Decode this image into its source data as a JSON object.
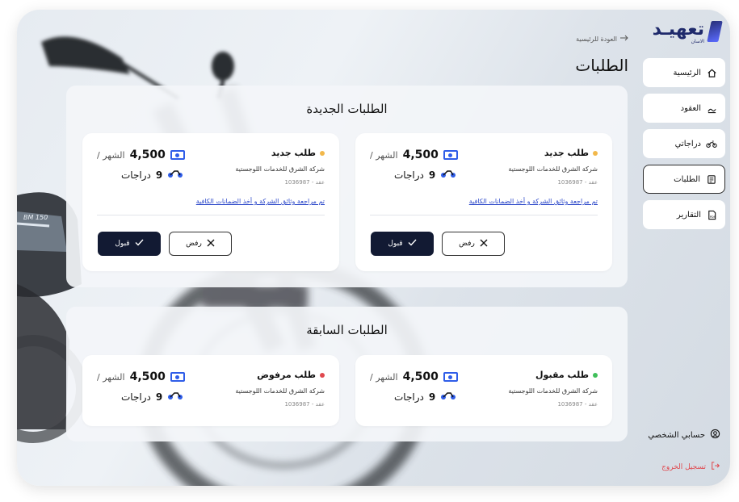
{
  "brand": {
    "name": "تعهيـد",
    "sub": "الاسان"
  },
  "nav": [
    {
      "label": "الرئيسية",
      "icon": "home-icon"
    },
    {
      "label": "العقود",
      "icon": "contract-icon"
    },
    {
      "label": "دراجاتي",
      "icon": "motorcycle-icon"
    },
    {
      "label": "الطلبات",
      "icon": "requests-icon",
      "active": true
    },
    {
      "label": "التقارير",
      "icon": "pdf-report-icon"
    }
  ],
  "profile": {
    "label": "حسابي الشخصي"
  },
  "logout": {
    "label": "تسجيل الخروج"
  },
  "header": {
    "back": "العودة للرئيسية",
    "title": "الطلبات"
  },
  "colors": {
    "accent": "#2f5de8",
    "pending": "#f2b84b",
    "accepted": "#3fbf5a",
    "rejected": "#e0484e",
    "dark": "#121a33"
  },
  "new_requests": {
    "title": "الطلبات الجديدة",
    "cards": [
      {
        "status": "طلب جديد",
        "company": "شركة الشرق للخدمات اللوجستية",
        "contract": "عقد - 1036987",
        "price": "4,500",
        "unit": "/ الشهر",
        "bikes_count": "9",
        "bikes_label": "دراجات",
        "link": "تم مراجعة وثائق الشركة و أخذ الضمانات الكافية",
        "reject": "رفض",
        "accept": "قبول"
      },
      {
        "status": "طلب جديد",
        "company": "شركة الشرق للخدمات اللوجستية",
        "contract": "عقد - 1036987",
        "price": "4,500",
        "unit": "/ الشهر",
        "bikes_count": "9",
        "bikes_label": "دراجات",
        "link": "تم مراجعة وثائق الشركة و أخذ الضمانات الكافية",
        "reject": "رفض",
        "accept": "قبول"
      }
    ]
  },
  "previous_requests": {
    "title": "الطلبات السابقة",
    "cards": [
      {
        "status": "طلب مقبول",
        "company": "شركة الشرق للخدمات اللوجستية",
        "contract": "عقد - 1036987",
        "price": "4,500",
        "unit": "/ الشهر",
        "bikes_count": "9",
        "bikes_label": "دراجات"
      },
      {
        "status": "طلب مرفوض",
        "company": "شركة الشرق للخدمات اللوجستية",
        "contract": "عقد - 1036987",
        "price": "4,500",
        "unit": "/ الشهر",
        "bikes_count": "9",
        "bikes_label": "دراجات"
      }
    ]
  },
  "background_badge": "BM 150"
}
